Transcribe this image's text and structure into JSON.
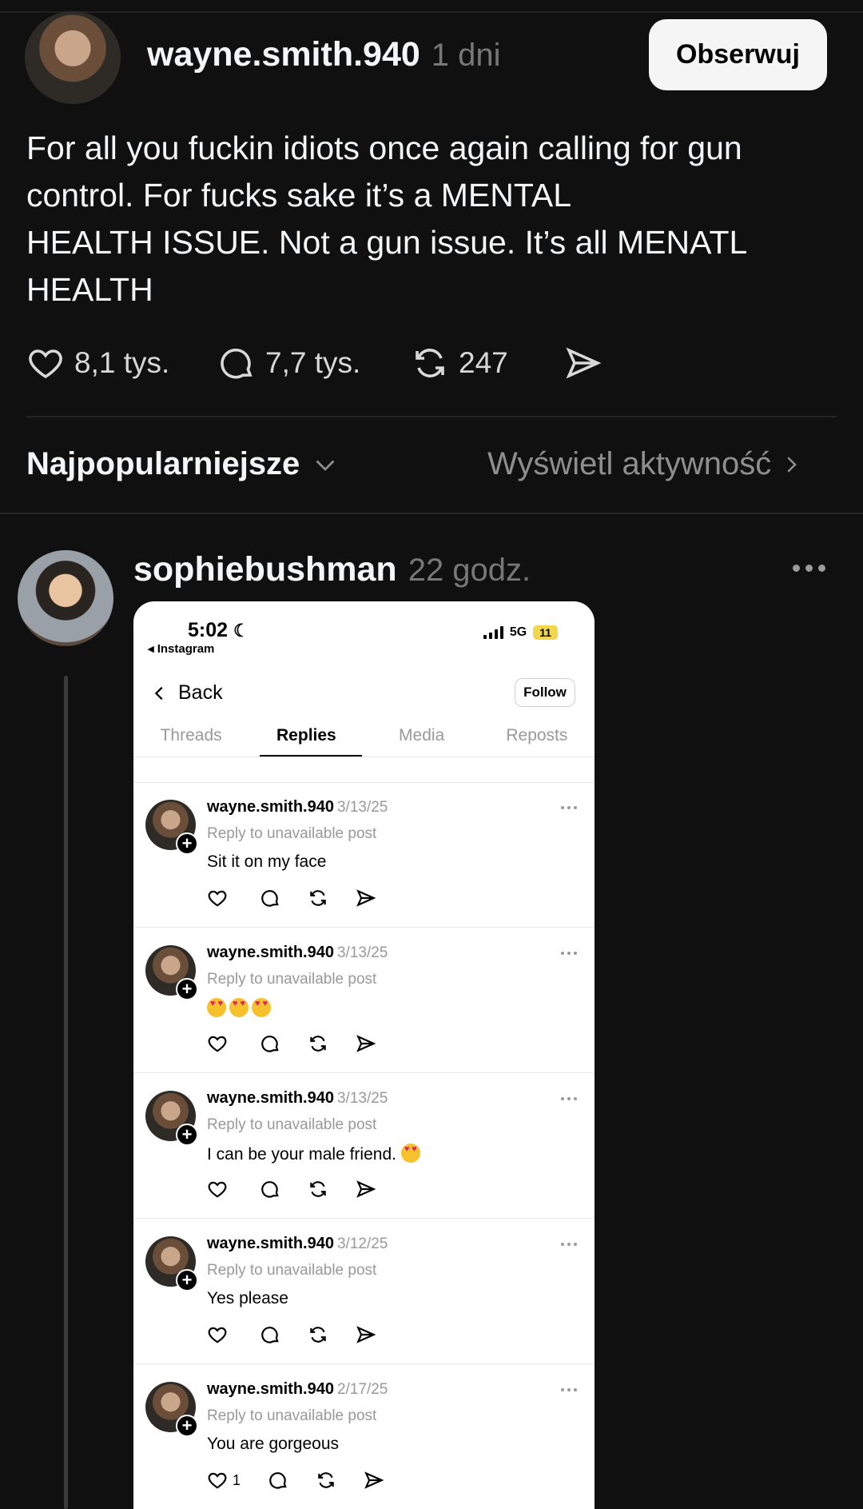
{
  "post": {
    "username": "wayne.smith.940",
    "time": "1 dni",
    "follow_label": "Obserwuj",
    "text": "For all you fuckin idiots once again calling for gun control.  For fucks sake it’s a MENTAL\nHEALTH ISSUE.  Not a gun issue.  It’s all MENATL\nHEALTH",
    "likes": "8,1 tys.",
    "comments": "7,7 tys.",
    "reposts": "247"
  },
  "sort": {
    "label": "Najpopularniejsze",
    "activity_label": "Wyświetl aktywność"
  },
  "reply": {
    "username": "sophiebushman",
    "time": "22 godz."
  },
  "screenshot": {
    "time": "5:02",
    "back_app": "◂ Instagram",
    "network": "5G",
    "battery": "11",
    "back_label": "Back",
    "follow_label": "Follow",
    "tabs": [
      "Threads",
      "Replies",
      "Media",
      "Reposts"
    ],
    "replies": [
      {
        "username": "wayne.smith.940",
        "date": "3/13/25",
        "context": "Reply to unavailable post",
        "text": "Sit it on my face",
        "likes": ""
      },
      {
        "username": "wayne.smith.940",
        "date": "3/13/25",
        "context": "Reply to unavailable post",
        "text": "",
        "emoji_count": 3,
        "likes": ""
      },
      {
        "username": "wayne.smith.940",
        "date": "3/13/25",
        "context": "Reply to unavailable post",
        "text": "I can be your male friend.",
        "emoji_count": 1,
        "likes": ""
      },
      {
        "username": "wayne.smith.940",
        "date": "3/12/25",
        "context": "Reply to unavailable post",
        "text": "Yes please",
        "likes": ""
      },
      {
        "username": "wayne.smith.940",
        "date": "2/17/25",
        "context": "Reply to unavailable post",
        "text": "You are gorgeous",
        "likes": "1"
      }
    ]
  },
  "colors": {
    "background": "#101010",
    "text_primary": "#f3f5f7",
    "text_secondary": "#777777",
    "follow_button": "#f5f5f5"
  }
}
